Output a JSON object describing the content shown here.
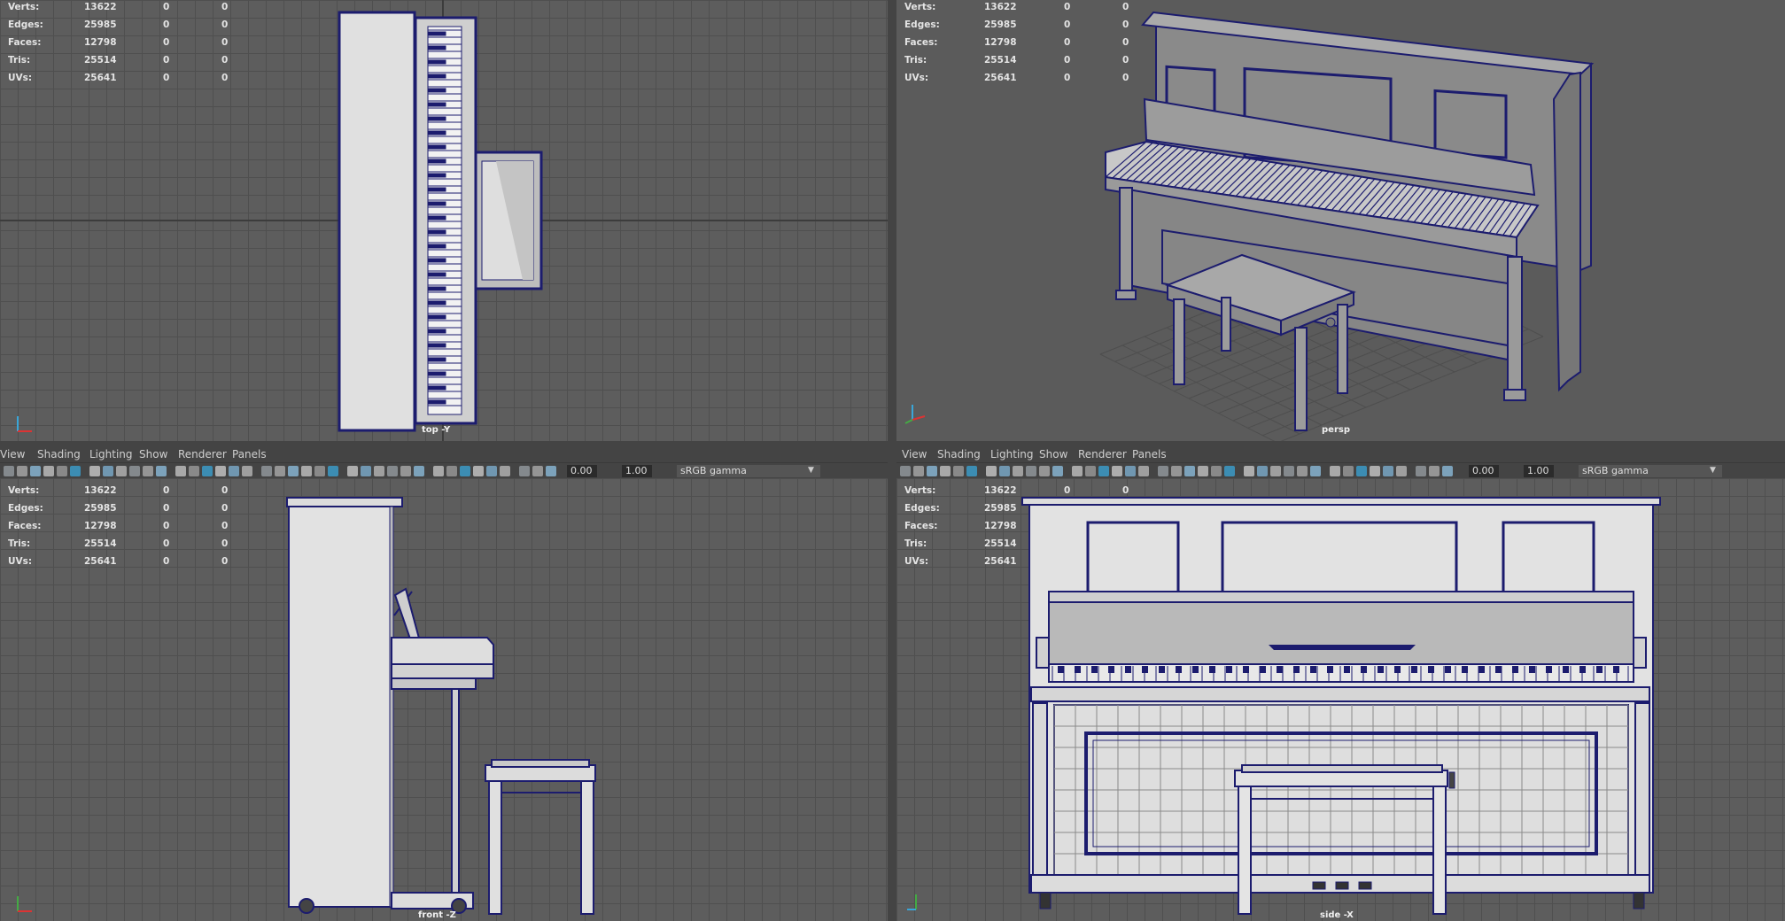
{
  "stats_labels": [
    "Verts:",
    "Edges:",
    "Faces:",
    "Tris:",
    "UVs:"
  ],
  "stats_values": [
    "13622",
    "25985",
    "12798",
    "25514",
    "25641"
  ],
  "zero": "0",
  "viewports": {
    "top": "top -Y",
    "persp": "persp",
    "front": "front -Z",
    "side": "side -X"
  },
  "menu": {
    "view": "View",
    "shading": "Shading",
    "lighting": "Lighting",
    "show": "Show",
    "renderer": "Renderer",
    "panels": "Panels"
  },
  "toolbar": {
    "exposure": "0.00",
    "gamma": "1.00",
    "color_space": "sRGB gamma"
  },
  "icons": {
    "axis": "axis-gizmo-icon",
    "dropdown": "chevron-down-icon"
  },
  "colors": {
    "wire": "#1c1c6e",
    "highlight": "#3aa6d8",
    "model_fill": "#dcdcdc"
  }
}
